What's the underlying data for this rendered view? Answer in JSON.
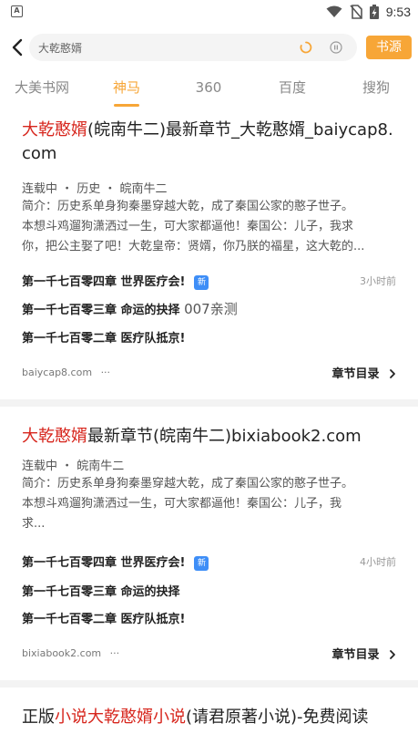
{
  "status_bar": {
    "app_icon": "A",
    "time": "9:53",
    "icons": [
      "wifi-icon",
      "no-sim-icon",
      "battery-charging-icon"
    ]
  },
  "search": {
    "query": "大乾憨婿",
    "button_label": "书源"
  },
  "tabs": [
    {
      "label": "大美书网",
      "active": false
    },
    {
      "label": "神马",
      "active": true
    },
    {
      "label": "360",
      "active": false
    },
    {
      "label": "百度",
      "active": false
    },
    {
      "label": "搜狗",
      "active": false
    }
  ],
  "results": [
    {
      "title_parts": [
        {
          "text": "大乾憨婿",
          "highlight": true
        },
        {
          "text": "(皖南牛二)最新章节_大乾憨婿_baiycap8.",
          "highlight": false
        }
      ],
      "title_line2": "com",
      "meta": "连载中 ・ 历史 ・ 皖南牛二",
      "summary_lines": [
        "简介：历史系单身狗秦墨穿越大乾，成了秦国公家的憨子世子。",
        "本想斗鸡遛狗潇洒过一生，可大家都逼他！秦国公：儿子，我求",
        "你，把公主娶了吧！大乾皇帝：贤婿，你乃朕的福星，这大乾的..."
      ],
      "chapters": [
        {
          "title": "第一千七百零四章 世界医疗会!",
          "badge": "新",
          "time": "3小时前"
        },
        {
          "title": "第一千七百零三章 命运的抉择",
          "extra": "007亲测"
        },
        {
          "title": "第一千七百零二章 医疗队抵京!"
        }
      ],
      "source": "baiycap8.com",
      "more": "···",
      "catalog_label": "章节目录"
    },
    {
      "title_parts": [
        {
          "text": "大乾憨婿",
          "highlight": true
        },
        {
          "text": "最新章节(皖南牛二)bixiabook2.com",
          "highlight": false
        }
      ],
      "meta": "连载中 ・ 皖南牛二",
      "summary_lines": [
        "简介：历史系单身狗秦墨穿越大乾，成了秦国公家的憨子世子。",
        "本想斗鸡遛狗潇洒过一生，可大家都逼他！秦国公：儿子，我",
        "求..."
      ],
      "chapters": [
        {
          "title": "第一千七百零四章 世界医疗会!",
          "badge": "新",
          "time": "4小时前"
        },
        {
          "title": "第一千七百零三章 命运的抉择"
        },
        {
          "title": "第一千七百零二章 医疗队抵京!"
        }
      ],
      "source": "bixiabook2.com",
      "more": "···",
      "catalog_label": "章节目录"
    },
    {
      "title_parts": [
        {
          "text": "正版",
          "highlight": false
        },
        {
          "text": "小说大乾憨婿小说",
          "highlight": true
        },
        {
          "text": "(请君原著小说)-免费阅读",
          "highlight": false
        }
      ]
    }
  ],
  "colors": {
    "accent": "#f7a637",
    "highlight": "#d7261d",
    "badge": "#3e8ef7",
    "separator": "#f3f3f3"
  }
}
